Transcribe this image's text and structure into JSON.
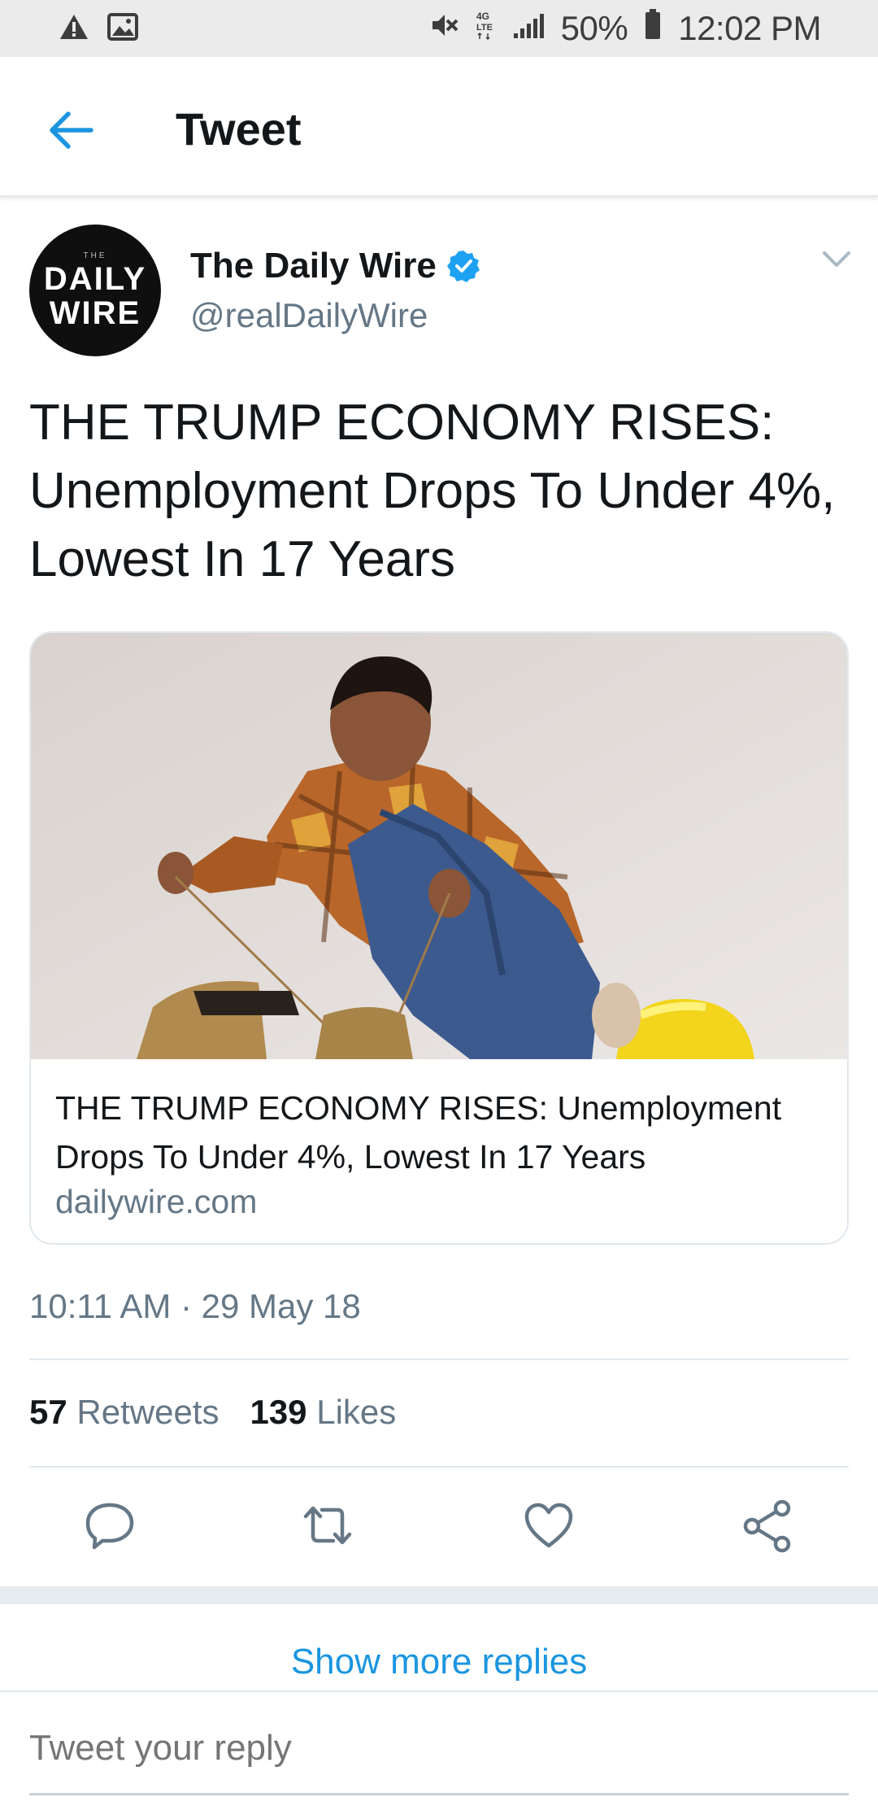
{
  "status_bar": {
    "battery": "50%",
    "time": "12:02 PM",
    "icons": [
      "warning-icon",
      "image-icon",
      "mute-icon",
      "lte-icon",
      "signal-icon",
      "battery-icon"
    ]
  },
  "header": {
    "title": "Tweet",
    "back_icon": "arrow-left-icon"
  },
  "author": {
    "name": "The Daily Wire",
    "handle": "@realDailyWire",
    "verified": true,
    "avatar": {
      "small": "THE",
      "line1": "DAILY",
      "line2": "WIRE"
    }
  },
  "tweet": {
    "text": "THE TRUMP ECONOMY RISES: Unemployment Drops To Under 4%, Lowest In 17 Years",
    "timestamp": "10:11 AM · 29 May 18"
  },
  "card": {
    "title": "THE TRUMP ECONOMY RISES: Unemployment Drops To Under 4%, Lowest In 17 Years",
    "domain": "dailywire.com"
  },
  "stats": {
    "retweets_count": "57",
    "retweets_label": "Retweets",
    "likes_count": "139",
    "likes_label": "Likes"
  },
  "actions": [
    "reply-icon",
    "retweet-icon",
    "like-icon",
    "share-icon"
  ],
  "colors": {
    "accent": "#1b95e0",
    "text": "#14171a",
    "muted": "#657786"
  },
  "show_more": "Show more replies",
  "reply": {
    "placeholder": "Tweet your reply"
  }
}
